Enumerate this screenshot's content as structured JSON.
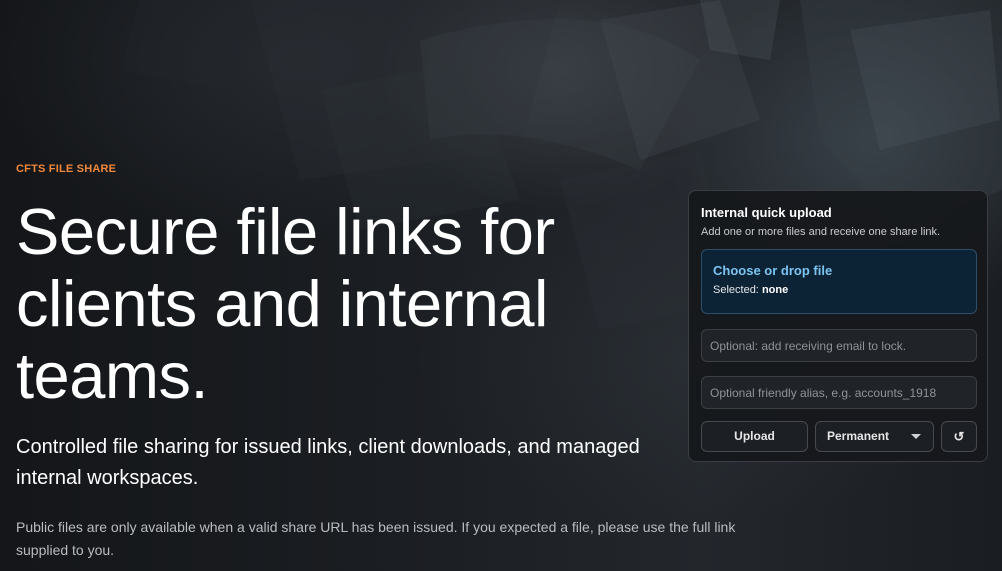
{
  "hero": {
    "eyebrow": "CFTS FILE SHARE",
    "headline": "Secure file links for clients and internal teams.",
    "subhead": "Controlled file sharing for issued links, client downloads, and managed internal workspaces.",
    "note": "Public files are only available when a valid share URL has been issued. If you expected a file, please use the full link supplied to you."
  },
  "upload_panel": {
    "title": "Internal quick upload",
    "subtitle": "Add one or more files and receive one share link.",
    "dropzone": {
      "label": "Choose or drop file",
      "selected_label": "Selected:",
      "selected_value": "none"
    },
    "email_placeholder": "Optional: add receiving email to lock.",
    "alias_placeholder": "Optional friendly alias, e.g. accounts_1918",
    "upload_label": "Upload",
    "expiry_value": "Permanent",
    "expiry_icon": "chevron-down-icon",
    "reset_symbol": "↺",
    "reset_icon": "refresh-icon"
  },
  "colors": {
    "accent": "#f0883c",
    "link": "#7cc4f2",
    "dropzone_bg": "#0c2235"
  }
}
